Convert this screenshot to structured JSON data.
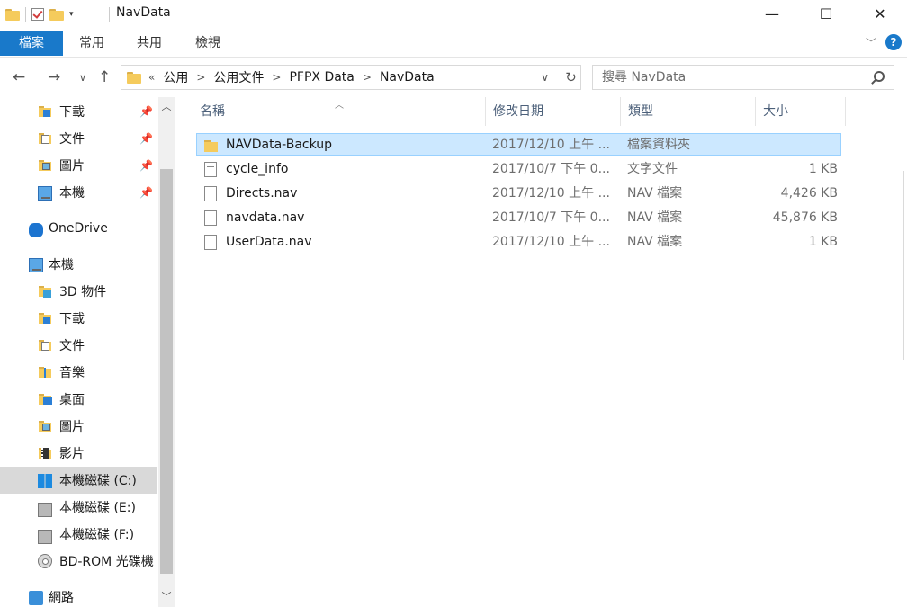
{
  "window": {
    "title": "NavData",
    "minimize_icon": "minimize-icon",
    "maximize_icon": "maximize-icon",
    "close_icon": "close-icon"
  },
  "ribbon": {
    "tabs": [
      "檔案",
      "常用",
      "共用",
      "檢視"
    ]
  },
  "address": {
    "overflow": "«",
    "crumbs": [
      "公用",
      "公用文件",
      "PFPX Data",
      "NavData"
    ],
    "search_placeholder": "搜尋 NavData"
  },
  "nav": {
    "quick_access": [
      {
        "label": "下載",
        "icon": "downloads-icon"
      },
      {
        "label": "文件",
        "icon": "documents-icon"
      },
      {
        "label": "圖片",
        "icon": "pictures-icon"
      },
      {
        "label": "本機",
        "icon": "this-pc-icon"
      }
    ],
    "onedrive": "OneDrive",
    "this_pc": "本機",
    "pc_items": [
      {
        "label": "3D 物件",
        "icon": "3d-objects-icon"
      },
      {
        "label": "下載",
        "icon": "downloads-icon"
      },
      {
        "label": "文件",
        "icon": "documents-icon"
      },
      {
        "label": "音樂",
        "icon": "music-icon"
      },
      {
        "label": "桌面",
        "icon": "desktop-icon"
      },
      {
        "label": "圖片",
        "icon": "pictures-icon"
      },
      {
        "label": "影片",
        "icon": "videos-icon"
      },
      {
        "label": "本機磁碟 (C:)",
        "icon": "windows-drive-icon"
      },
      {
        "label": "本機磁碟 (E:)",
        "icon": "drive-icon"
      },
      {
        "label": "本機磁碟 (F:)",
        "icon": "drive-icon"
      },
      {
        "label": "BD-ROM 光碟機",
        "icon": "disc-drive-icon"
      }
    ],
    "network": "網路"
  },
  "columns": {
    "name": "名稱",
    "date": "修改日期",
    "type": "類型",
    "size": "大小"
  },
  "files": [
    {
      "name": "NAVData-Backup",
      "date": "2017/12/10 上午 ...",
      "type": "檔案資料夾",
      "size": "",
      "kind": "folder"
    },
    {
      "name": "cycle_info",
      "date": "2017/10/7 下午 0...",
      "type": "文字文件",
      "size": "1 KB",
      "kind": "text"
    },
    {
      "name": "Directs.nav",
      "date": "2017/12/10 上午 ...",
      "type": "NAV 檔案",
      "size": "4,426 KB",
      "kind": "file"
    },
    {
      "name": "navdata.nav",
      "date": "2017/10/7 下午 0...",
      "type": "NAV 檔案",
      "size": "45,876 KB",
      "kind": "file"
    },
    {
      "name": "UserData.nav",
      "date": "2017/12/10 上午 ...",
      "type": "NAV 檔案",
      "size": "1 KB",
      "kind": "file"
    }
  ],
  "colors": {
    "accent": "#1979ca",
    "selected_row": "#cce8ff",
    "selected_nav": "#d9d9d9"
  }
}
